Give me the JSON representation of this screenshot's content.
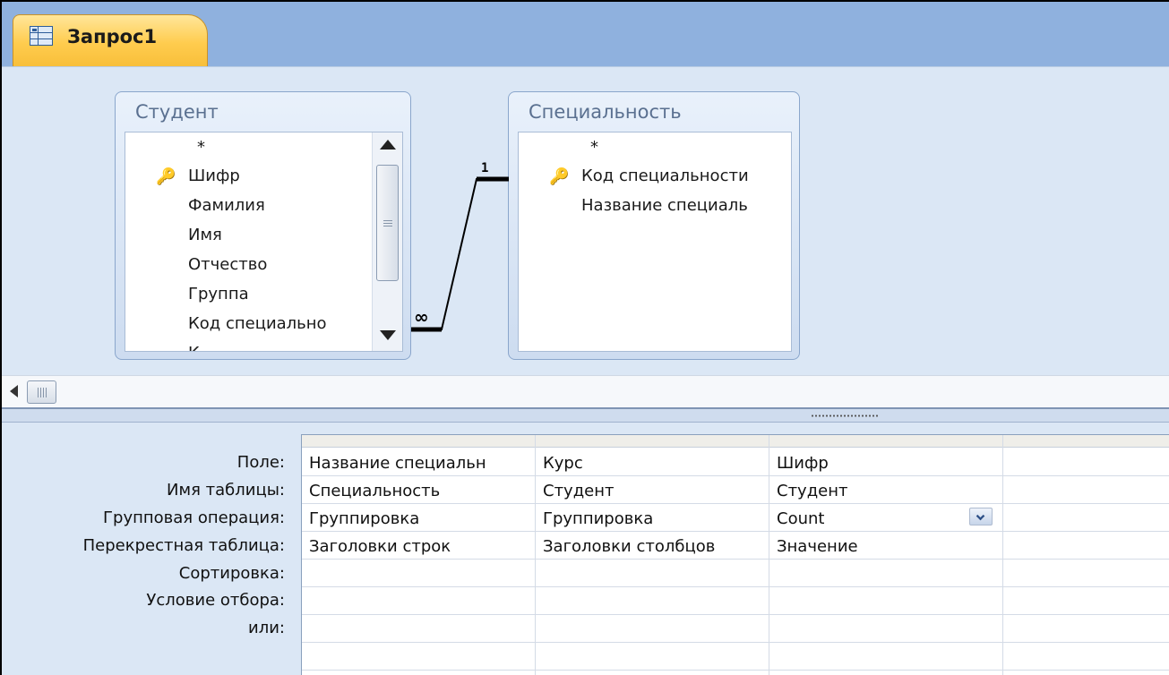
{
  "tab": {
    "label": "Запрос1",
    "icon": "query-icon"
  },
  "tables": {
    "student": {
      "title": "Студент",
      "fields": [
        "*",
        "Шифр",
        "Фамилия",
        "Имя",
        "Отчество",
        "Группа",
        "Код специально",
        "К"
      ],
      "key_field": "Шифр"
    },
    "specialty": {
      "title": "Специальность",
      "fields": [
        "*",
        "Код специальности",
        "Название специаль"
      ],
      "key_field": "Код специальности"
    }
  },
  "relationship": {
    "one_label": "1",
    "many_label": "∞"
  },
  "grid": {
    "row_labels": [
      "Поле:",
      "Имя таблицы:",
      "Групповая операция:",
      "Перекрестная таблица:",
      "Сортировка:",
      "Условие отбора:",
      "или:"
    ],
    "columns": [
      {
        "field": "Название специальн",
        "table": "Специальность",
        "group": "Группировка",
        "crosstab": "Заголовки строк"
      },
      {
        "field": "Курс",
        "table": "Студент",
        "group": "Группировка",
        "crosstab": "Заголовки столбцов"
      },
      {
        "field": "Шифр",
        "table": "Студент",
        "group": "Count",
        "crosstab": "Значение"
      }
    ]
  },
  "colors": {
    "tab": "#ffcc4e",
    "pane": "#dbe7f5",
    "header": "#8fb1de"
  }
}
